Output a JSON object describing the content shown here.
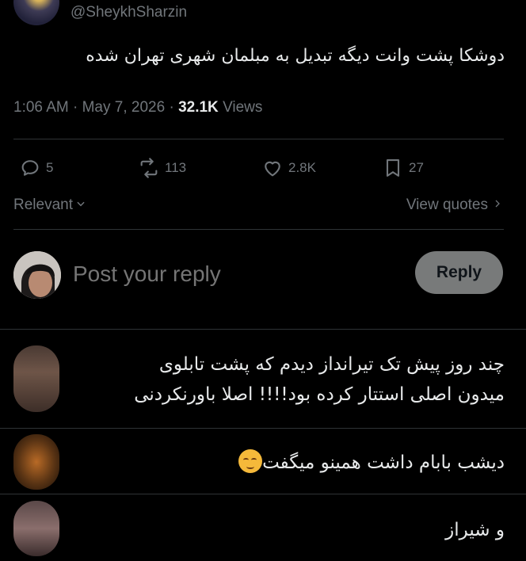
{
  "tweet": {
    "handle": "@SheykhSharzin",
    "text": "دوشکا پشت وانت دیگه تبدیل به مبلمان شهری تهران شده",
    "time": "1:06 AM",
    "dot1": "·",
    "date": "May 7, 2026",
    "dot2": "·",
    "views_count": "32.1K",
    "views_label": "Views"
  },
  "actions": {
    "replies": "5",
    "reposts": "113",
    "likes": "2.8K",
    "bookmarks": "27"
  },
  "sort": {
    "relevant": "Relevant",
    "view_quotes": "View quotes"
  },
  "compose": {
    "placeholder": "Post your reply",
    "reply_button": "Reply"
  },
  "replies": [
    {
      "line1": "چند روز پیش تک تیرانداز دیدم که پشت تابلوی",
      "line2": "میدون اصلی استتار کرده بود!!!! اصلا باورنکردنی"
    },
    {
      "text": "دیشب بابام داشت همینو میگفت",
      "emoji": "relieved-face-emoji"
    },
    {
      "text": "و شیراز"
    }
  ],
  "colors": {
    "muted": "#71767b",
    "text": "#e7e9ea",
    "divider": "#2f3336",
    "reply_button_bg": "#787a7a"
  }
}
